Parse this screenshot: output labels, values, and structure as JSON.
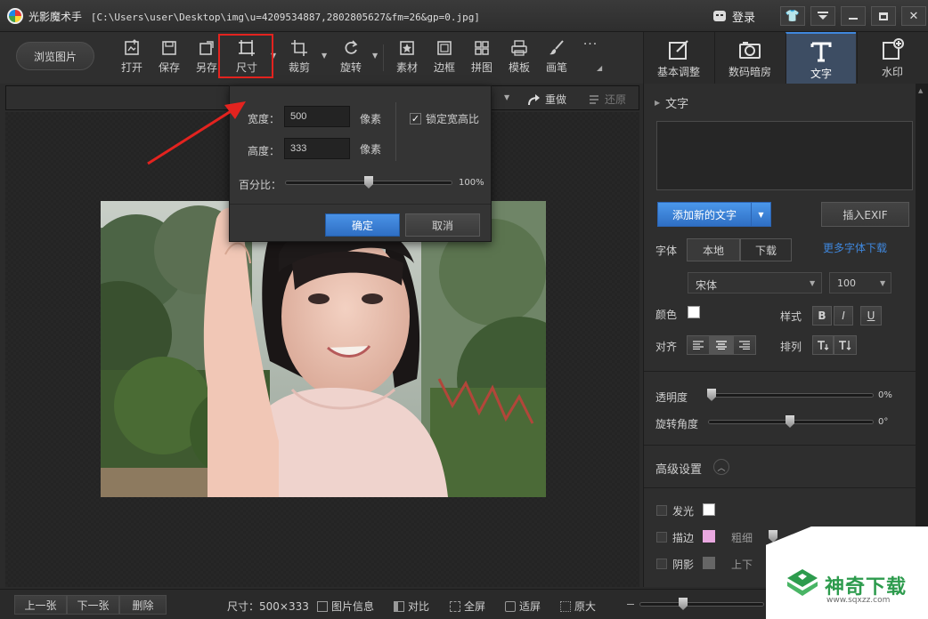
{
  "window": {
    "app_name": "光影魔术手",
    "file_path": "[C:\\Users\\user\\Desktop\\img\\u=4209534887,2802805627&fm=26&gp=0.jpg]",
    "login_label": "登录"
  },
  "toolbar": {
    "browse_label": "浏览图片",
    "tools": [
      {
        "label": "打开",
        "icon": "open-icon"
      },
      {
        "label": "保存",
        "icon": "save-icon"
      },
      {
        "label": "另存",
        "icon": "save-as-icon"
      },
      {
        "label": "尺寸",
        "icon": "resize-icon"
      },
      {
        "label": "裁剪",
        "icon": "crop-icon"
      },
      {
        "label": "旋转",
        "icon": "rotate-icon"
      },
      {
        "label": "素材",
        "icon": "sticker-icon"
      },
      {
        "label": "边框",
        "icon": "frame-icon"
      },
      {
        "label": "拼图",
        "icon": "collage-icon"
      },
      {
        "label": "模板",
        "icon": "template-icon"
      },
      {
        "label": "画笔",
        "icon": "brush-icon"
      }
    ],
    "more_label": "···"
  },
  "right_tabs": [
    {
      "label": "基本调整",
      "icon": "adjust-icon"
    },
    {
      "label": "数码暗房",
      "icon": "darkroom-icon"
    },
    {
      "label": "文字",
      "icon": "text-icon"
    },
    {
      "label": "水印",
      "icon": "watermark-icon"
    }
  ],
  "edit_strip": {
    "redo_label": "重做",
    "restore_label": "还原"
  },
  "size_dialog": {
    "width_label": "宽度：",
    "width_value": "500",
    "height_label": "高度：",
    "height_value": "333",
    "unit_label": "像素",
    "lock_ratio_label": "锁定宽高比",
    "percent_label": "百分比：",
    "percent_value": "100%",
    "percent_level": 0.5,
    "ok_label": "确定",
    "cancel_label": "取消"
  },
  "text_panel": {
    "section_title": "文字",
    "add_text_label": "添加新的文字",
    "insert_exif_label": "插入EXIF",
    "font_label": "字体",
    "local_label": "本地",
    "download_label": "下载",
    "more_fonts_label": "更多字体下载",
    "font_name": "宋体",
    "font_size": "100",
    "color_label": "颜色",
    "style_label": "样式",
    "style_bold": "B",
    "style_italic": "I",
    "style_underline": "U",
    "align_label": "对齐",
    "arrange_label": "排列",
    "opacity_label": "透明度",
    "opacity_value": "0%",
    "rotation_label": "旋转角度",
    "rotation_value": "0°",
    "advanced_label": "高级设置",
    "glow_label": "发光",
    "stroke_label": "描边",
    "thickness_label": "粗细",
    "shadow_label": "阴影",
    "updown_label": "上下",
    "colors": {
      "text_color": "#ffffff",
      "glow_color": "#ffffff",
      "stroke_color": "#e9a8e0",
      "shadow_color": "#666666",
      "accent": "#3f87dd"
    }
  },
  "bottom_bar": {
    "prev_label": "上一张",
    "next_label": "下一张",
    "delete_label": "删除",
    "size_info": "尺寸：500×333",
    "info_label": "图片信息",
    "compare_label": "对比",
    "fullscreen_label": "全屏",
    "fit_label": "适屏",
    "original_label": "原大"
  },
  "watermark": {
    "text": "神奇下载",
    "url": "www.sqxzz.com"
  }
}
